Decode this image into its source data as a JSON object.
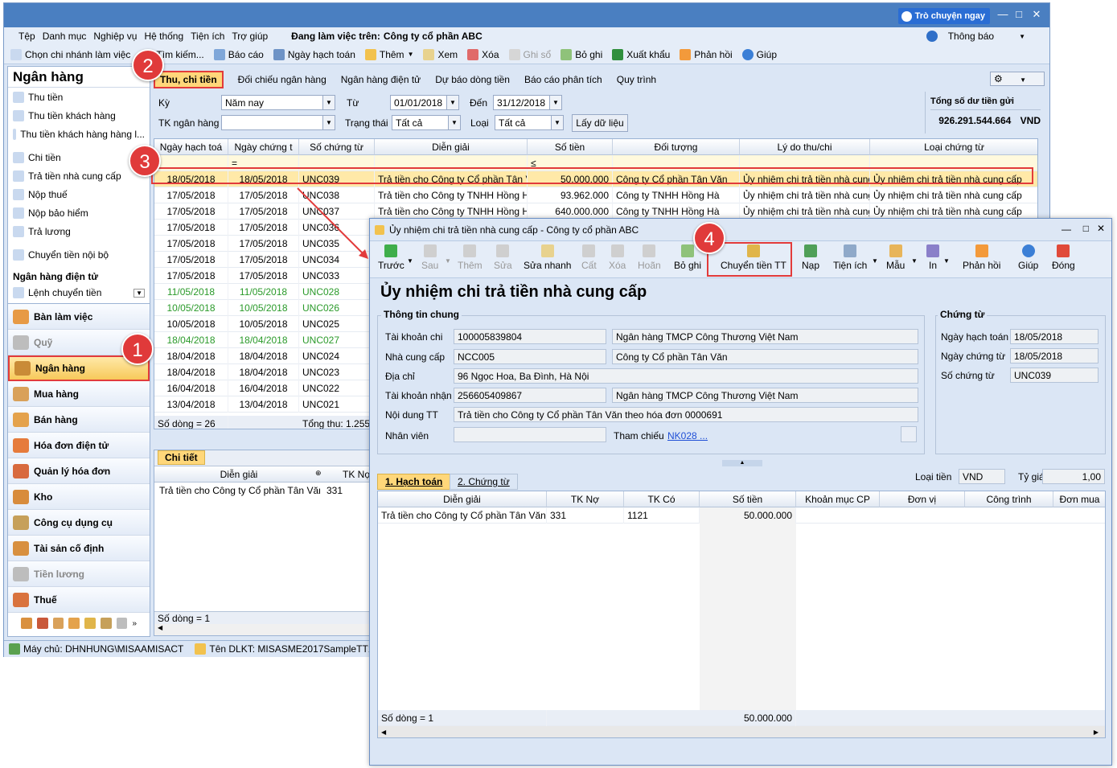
{
  "main": {
    "chat_button": "Trò chuyện ngay",
    "menu": [
      "Tệp",
      "Danh mục",
      "Nghiệp vụ",
      "Hệ thống",
      "Tiện ích",
      "Trợ giúp"
    ],
    "working_label": "Đang làm việc trên:",
    "company": "Công ty cổ phần ABC",
    "notify": "Thông báo",
    "toolbar": {
      "branch": "Chọn chi nhánh làm việc",
      "search": "Tìm kiếm...",
      "report": "Báo cáo",
      "posting_date": "Ngày hạch toán",
      "add": "Thêm",
      "view": "Xem",
      "delete": "Xóa",
      "post": "Ghi sổ",
      "unpost": "Bỏ ghi",
      "export": "Xuất khẩu",
      "feedback": "Phản hồi",
      "help": "Giúp"
    }
  },
  "left": {
    "title": "Ngân hàng",
    "items": [
      "Thu tiền",
      "Thu tiền khách hàng",
      "Thu tiền khách hàng hàng l...",
      "Chi tiền",
      "Trả tiền nhà cung cấp",
      "Nộp thuế",
      "Nộp bảo hiểm",
      "Trả lương",
      "Chuyển tiền nội bộ"
    ],
    "ebank_title": "Ngân hàng điện tử",
    "ebank_item": "Lệnh chuyển tiền",
    "modules": [
      "Bàn làm việc",
      "Quỹ",
      "Ngân hàng",
      "Mua hàng",
      "Bán hàng",
      "Hóa đơn điện tử",
      "Quản lý hóa đơn",
      "Kho",
      "Công cụ dụng cụ",
      "Tài sản cố định",
      "Tiền lương",
      "Thuế"
    ]
  },
  "tabs": [
    "Thu, chi tiền",
    "Đối chiếu ngân hàng",
    "Ngân hàng điện tử",
    "Dự báo dòng tiền",
    "Báo cáo phân tích",
    "Quy trình"
  ],
  "filters": {
    "period_label": "Kỳ",
    "period_value": "Năm nay",
    "from_label": "Từ",
    "from_value": "01/01/2018",
    "to_label": "Đến",
    "to_value": "31/12/2018",
    "account_label": "TK ngân hàng",
    "status_label": "Trạng thái",
    "status_value": "Tất cả",
    "type_label": "Loại",
    "type_value": "Tất cả",
    "fetch_button": "Lấy dữ liệu",
    "balance_label": "Tổng số dư tiền gửi",
    "balance_value": "926.291.544.664",
    "balance_currency": "VND"
  },
  "grid": {
    "headers": [
      "Ngày hạch toá",
      "Ngày chứng t",
      "Số chứng từ",
      "Diễn giải",
      "Số tiền",
      "Đối tượng",
      "Lý do thu/chi",
      "Loại chứng từ"
    ],
    "filter_ops": [
      "",
      "=",
      "",
      "",
      "≤",
      "",
      "",
      ""
    ],
    "rows": [
      {
        "d1": "18/05/2018",
        "d2": "18/05/2018",
        "no": "UNC039",
        "desc": "Trả tiền cho Công ty Cổ phần Tân V",
        "amt": "50.000.000",
        "obj": "Công ty Cổ phần Tân Văn",
        "reason": "Ủy nhiệm chi trả tiền nhà cung",
        "type": "Ủy nhiệm chi trả tiền nhà cung cấp"
      },
      {
        "d1": "17/05/2018",
        "d2": "17/05/2018",
        "no": "UNC038",
        "desc": "Trả tiền cho Công ty TNHH Hồng H",
        "amt": "93.962.000",
        "obj": "Công ty TNHH Hồng Hà",
        "reason": "Ủy nhiệm chi trả tiền nhà cung",
        "type": "Ủy nhiệm chi trả tiền nhà cung cấp"
      },
      {
        "d1": "17/05/2018",
        "d2": "17/05/2018",
        "no": "UNC037",
        "desc": "Trả tiền cho Công ty TNHH Hồng H",
        "amt": "640.000.000",
        "obj": "Công ty TNHH Hồng Hà",
        "reason": "Ủy nhiệm chi trả tiền nhà cung",
        "type": "Ủy nhiệm chi trả tiền nhà cung cấp"
      },
      {
        "d1": "17/05/2018",
        "d2": "17/05/2018",
        "no": "UNC036"
      },
      {
        "d1": "17/05/2018",
        "d2": "17/05/2018",
        "no": "UNC035"
      },
      {
        "d1": "17/05/2018",
        "d2": "17/05/2018",
        "no": "UNC034"
      },
      {
        "d1": "17/05/2018",
        "d2": "17/05/2018",
        "no": "UNC033"
      },
      {
        "d1": "11/05/2018",
        "d2": "11/05/2018",
        "no": "UNC028",
        "green": true
      },
      {
        "d1": "10/05/2018",
        "d2": "10/05/2018",
        "no": "UNC026",
        "green": true
      },
      {
        "d1": "10/05/2018",
        "d2": "10/05/2018",
        "no": "UNC025"
      },
      {
        "d1": "18/04/2018",
        "d2": "18/04/2018",
        "no": "UNC027",
        "green": true
      },
      {
        "d1": "18/04/2018",
        "d2": "18/04/2018",
        "no": "UNC024"
      },
      {
        "d1": "18/04/2018",
        "d2": "18/04/2018",
        "no": "UNC023"
      },
      {
        "d1": "16/04/2018",
        "d2": "16/04/2018",
        "no": "UNC022"
      },
      {
        "d1": "13/04/2018",
        "d2": "13/04/2018",
        "no": "UNC021"
      }
    ],
    "row_count": "Số dòng = 26",
    "total": "Tổng thu: 1.255..."
  },
  "detail": {
    "tab": "Chi tiết",
    "headers": [
      "Diễn giải",
      "TK Nợ"
    ],
    "row": [
      "Trả tiền cho Công ty Cổ phần Tân Văn t",
      "331"
    ],
    "row_count": "Số dòng = 1"
  },
  "status": {
    "server": "Máy chủ: DHNHUNG\\MISAAMISACT",
    "db": "Tên DLKT: MISASME2017SampleTT133"
  },
  "dialog": {
    "title": "Ủy nhiệm chi trả tiền nhà cung cấp - Công ty cổ phần ABC",
    "toolbar": [
      "Trước",
      "Sau",
      "Thêm",
      "Sửa",
      "Sửa nhanh",
      "Cất",
      "Xóa",
      "Hoãn",
      "Bỏ ghi",
      "Chuyển tiền TT",
      "Nạp",
      "Tiện ích",
      "Mẫu",
      "In",
      "Phản hồi",
      "Giúp",
      "Đóng"
    ],
    "heading": "Ủy nhiệm chi trả tiền nhà cung cấp",
    "general_title": "Thông tin chung",
    "labels": {
      "account": "Tài khoản chi",
      "supplier": "Nhà cung cấp",
      "address": "Địa chỉ",
      "recv_account": "Tài khoản nhận",
      "content": "Nội dung TT",
      "staff": "Nhân viên",
      "ref": "Tham chiếu"
    },
    "values": {
      "account": "100005839804",
      "account_bank": "Ngân hàng TMCP Công Thương Việt Nam",
      "supplier": "NCC005",
      "supplier_name": "Công ty Cổ phần Tân Văn",
      "address": "96 Ngọc Hoa, Ba Đình, Hà Nội",
      "recv_account": "256605409867",
      "recv_bank": "Ngân hàng TMCP Công Thương Việt Nam",
      "content": "Trả tiền cho Công ty Cổ phần Tân Văn theo hóa đơn 0000691",
      "ref": "NK028 ..."
    },
    "voucher_title": "Chứng từ",
    "voucher": {
      "posting_label": "Ngày hạch toán",
      "posting": "18/05/2018",
      "doc_label": "Ngày chứng từ",
      "doc": "18/05/2018",
      "no_label": "Số chứng từ",
      "no": "UNC039"
    },
    "tabs": [
      "1. Hạch toán",
      "2. Chứng từ"
    ],
    "currency_label": "Loại tiền",
    "currency": "VND",
    "rate_label": "Tỷ giá",
    "rate": "1,00",
    "grid_headers": [
      "Diễn giải",
      "TK Nợ",
      "TK Có",
      "Số tiền",
      "Khoản mục CP",
      "Đơn vị",
      "Công trình",
      "Đơn mua"
    ],
    "grid_row": [
      "Trả tiền cho Công ty Cổ phần Tân Văn t",
      "331",
      "1121",
      "50.000.000"
    ],
    "row_count": "Số dòng = 1",
    "total": "50.000.000"
  },
  "badges": [
    "1",
    "2",
    "3",
    "4"
  ],
  "colors": {
    "accent": "#e23b3b",
    "title_bar": "#4a7fc1",
    "highlight": "#ffd77a"
  }
}
